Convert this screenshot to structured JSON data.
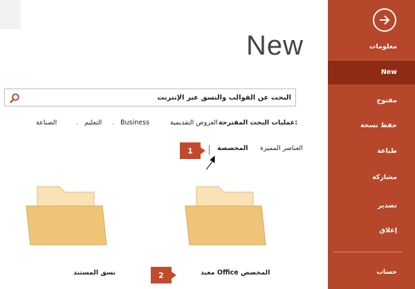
{
  "main": {
    "title": "New",
    "search": {
      "value": "البحث عن القوالب والنسق عبر الإنترنت"
    },
    "suggested": {
      "label": "عمليات البحث المقترحة:",
      "links": [
        "العروض التقديمية",
        "Business",
        "التعليم",
        "الصناعة"
      ]
    },
    "tabs": {
      "featured": "العناصر المميزة",
      "personal": "المخصصة"
    },
    "callouts": {
      "one": "1",
      "two": "2"
    },
    "folders": [
      {
        "label": "معيد Office المخصص"
      },
      {
        "label": "نسق المستند"
      }
    ]
  },
  "sidebar": {
    "items": [
      {
        "label": "معلومات"
      },
      {
        "label": "New"
      },
      {
        "label": "مفتوح"
      },
      {
        "label": "حفظ نسخة"
      },
      {
        "label": "طباعة"
      },
      {
        "label": "مشاركة"
      },
      {
        "label": "تصدير"
      },
      {
        "label": "إغلاق"
      },
      {
        "label": "حساب"
      }
    ]
  },
  "colors": {
    "sidebar": "#b7472a",
    "sidebar_active": "#8e2b14",
    "callout": "#c3492b",
    "folder": "#f0c478"
  },
  "icons": {
    "back": "circle-arrow-right-icon",
    "search": "magnifier-icon",
    "folder": "folder-icon",
    "cursor": "mouse-pointer-icon"
  }
}
